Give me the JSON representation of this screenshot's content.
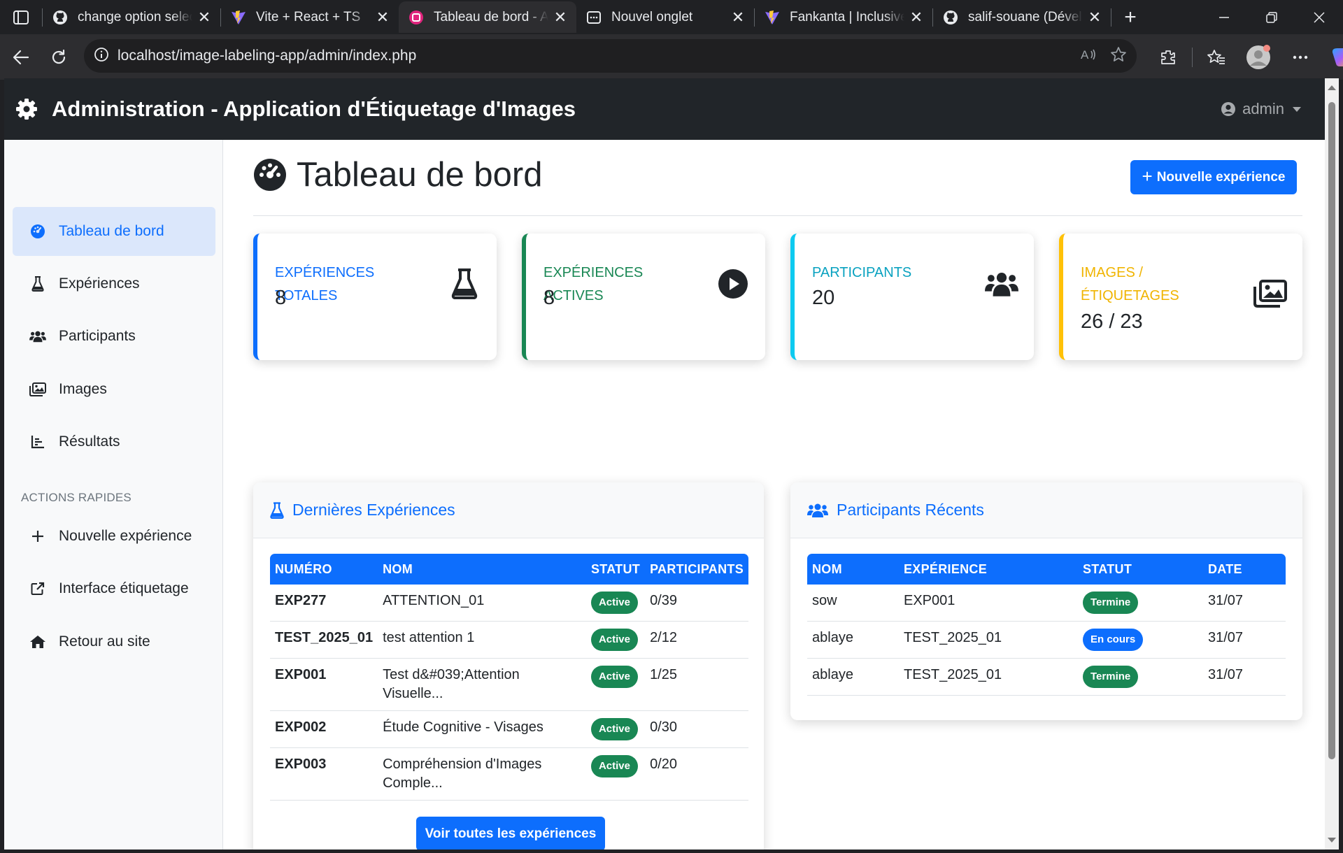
{
  "browser": {
    "tabs": [
      {
        "title": "change option select",
        "favicon": "github-icon"
      },
      {
        "title": "Vite + React + TS",
        "favicon": "vite-icon"
      },
      {
        "title": "Tableau de bord - Application",
        "favicon": "app-icon",
        "active": true
      },
      {
        "title": "Nouvel onglet",
        "favicon": "newtab-icon"
      },
      {
        "title": "Fankanta | Inclusive Ed",
        "favicon": "vite-icon"
      },
      {
        "title": "salif-souane (Développeur)",
        "favicon": "github-icon"
      }
    ],
    "url": "localhost/image-labeling-app/admin/index.php"
  },
  "navbar": {
    "brand": "Administration - Application d'Étiquetage d'Images",
    "user": "admin"
  },
  "sidebar": {
    "items": [
      {
        "label": "Tableau de bord",
        "icon": "gauge-icon",
        "active": true
      },
      {
        "label": "Expériences",
        "icon": "flask-icon"
      },
      {
        "label": "Participants",
        "icon": "users-icon"
      },
      {
        "label": "Images",
        "icon": "images-icon"
      },
      {
        "label": "Résultats",
        "icon": "chart-icon"
      }
    ],
    "quick_heading": "ACTIONS RAPIDES",
    "quick_items": [
      {
        "label": "Nouvelle expérience",
        "icon": "plus-icon"
      },
      {
        "label": "Interface étiquetage",
        "icon": "external-link-icon"
      },
      {
        "label": "Retour au site",
        "icon": "home-icon"
      }
    ]
  },
  "main": {
    "title": "Tableau de bord",
    "new_button": "Nouvelle expérience",
    "stats": [
      {
        "label": "EXPÉRIENCES TOTALES",
        "value": "8",
        "color": "#0d6efd",
        "icon": "flask-icon"
      },
      {
        "label": "EXPÉRIENCES ACTIVES",
        "value": "8",
        "color": "#198754",
        "icon": "play-circle-icon"
      },
      {
        "label": "PARTICIPANTS",
        "value": "20",
        "color": "#0dcaf0",
        "icon": "users-icon"
      },
      {
        "label": "IMAGES / ÉTIQUETAGES",
        "value": "26 / 23",
        "color": "#ffc107",
        "icon": "images-icon"
      }
    ],
    "latest_experiments": {
      "title": "Dernières Expériences",
      "columns": [
        "NUMÉRO",
        "NOM",
        "STATUT",
        "PARTICIPANTS"
      ],
      "rows": [
        {
          "num": "EXP277",
          "name": "ATTENTION_01",
          "status": "Active",
          "participants": "0/39"
        },
        {
          "num": "TEST_2025_01",
          "name": "test attention 1",
          "status": "Active",
          "participants": "2/12"
        },
        {
          "num": "EXP001",
          "name": "Test d&#039;Attention Visuelle...",
          "status": "Active",
          "participants": "1/25"
        },
        {
          "num": "EXP002",
          "name": "Étude Cognitive - Visages",
          "status": "Active",
          "participants": "0/30"
        },
        {
          "num": "EXP003",
          "name": "Compréhension d'Images Comple...",
          "status": "Active",
          "participants": "0/20"
        }
      ],
      "view_all": "Voir toutes les expériences"
    },
    "recent_participants": {
      "title": "Participants Récents",
      "columns": [
        "NOM",
        "EXPÉRIENCE",
        "STATUT",
        "DATE"
      ],
      "rows": [
        {
          "name": "sow",
          "experiment": "EXP001",
          "status": "Termine",
          "status_color": "#198754",
          "date": "31/07"
        },
        {
          "name": "ablaye",
          "experiment": "TEST_2025_01",
          "status": "En cours",
          "status_color": "#0d6efd",
          "date": "31/07"
        },
        {
          "name": "ablaye",
          "experiment": "TEST_2025_01",
          "status": "Termine",
          "status_color": "#198754",
          "date": "31/07"
        }
      ]
    }
  }
}
